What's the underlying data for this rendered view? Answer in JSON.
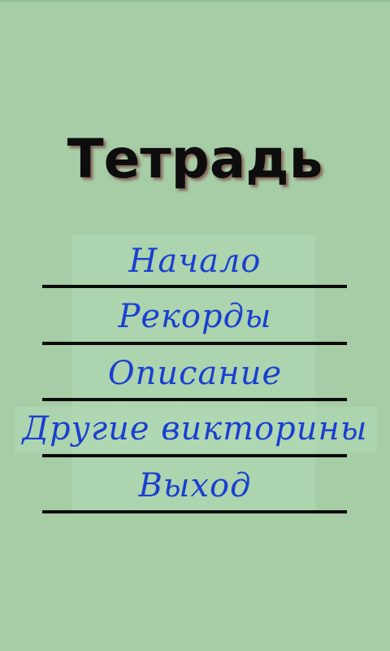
{
  "app": {
    "title": "Тетрадь"
  },
  "menu": {
    "items": [
      {
        "id": "start",
        "label": "Начало"
      },
      {
        "id": "records",
        "label": "Рекорды"
      },
      {
        "id": "description",
        "label": "Описание"
      },
      {
        "id": "other-quizzes",
        "label": "Другие викторины"
      },
      {
        "id": "exit",
        "label": "Выход"
      }
    ]
  },
  "colors": {
    "background": "#a6cda6",
    "menu_text": "#1a3fd1",
    "title_text": "#0d0d0d",
    "title_shadow": "#6e141e",
    "rule": "#0b0b0b"
  }
}
